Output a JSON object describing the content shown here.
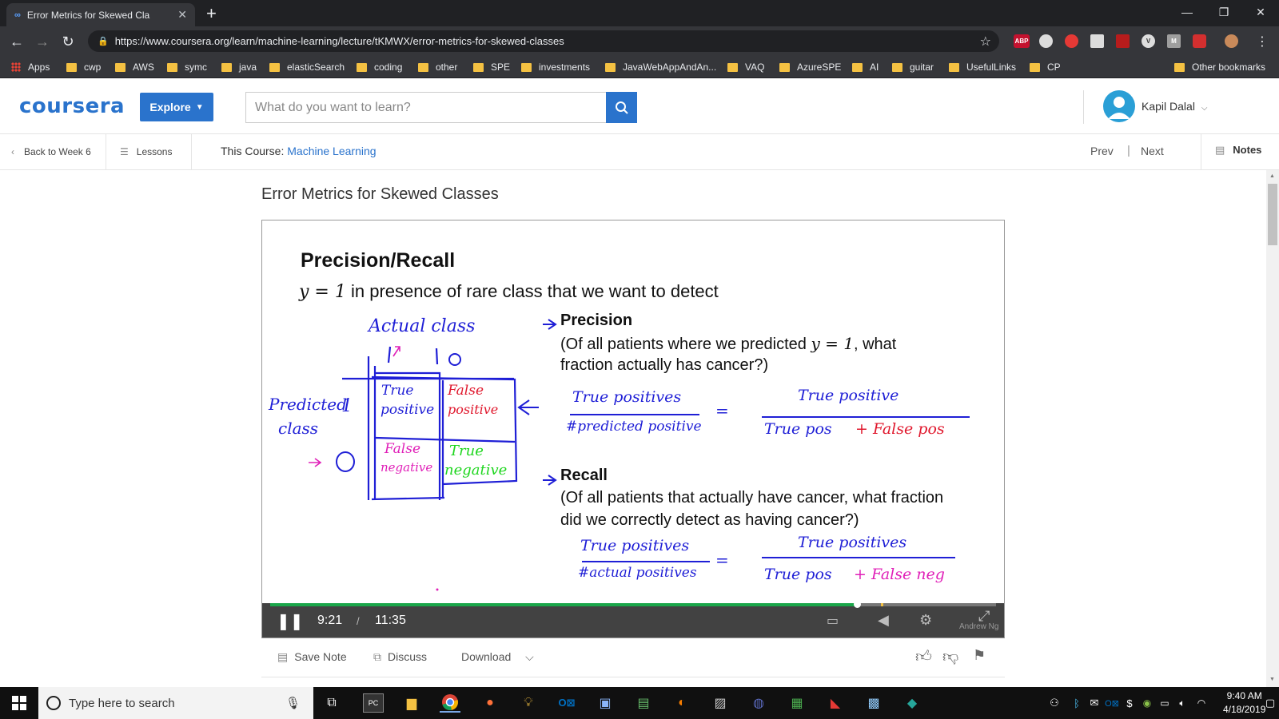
{
  "browser": {
    "tab_title": "Error Metrics for Skewed Cla",
    "url": "https://www.coursera.org/learn/machine-learning/lecture/tKMWX/error-metrics-for-skewed-classes",
    "bookmarks": [
      "Apps",
      "cwp",
      "AWS",
      "symc",
      "java",
      "elasticSearch",
      "coding",
      "other",
      "SPE",
      "investments",
      "JavaWebAppAndAn...",
      "VAQ",
      "AzureSPE",
      "AI",
      "guitar",
      "UsefulLinks",
      "CP"
    ],
    "other_bookmarks": "Other bookmarks",
    "extensions": [
      "ABP",
      "",
      "",
      "",
      "",
      "V",
      "M",
      ""
    ]
  },
  "header": {
    "logo": "coursera",
    "explore_label": "Explore",
    "search_placeholder": "What do you want to learn?",
    "user_name": "Kapil Dalal"
  },
  "course_nav": {
    "back": "Back to Week 6",
    "lessons": "Lessons",
    "course_prefix": "This Course:",
    "course_name": "Machine Learning",
    "prev": "Prev",
    "next": "Next",
    "notes": "Notes"
  },
  "lecture": {
    "title": "Error Metrics for Skewed Classes"
  },
  "slide": {
    "heading": "Precision/Recall",
    "subtitle": "in presence of rare class that we want to detect",
    "subtitle_math": "y = 1",
    "precision_title": "Precision",
    "precision_line1a": "(Of all patients where we predicted",
    "precision_line1_math": "y = 1",
    "precision_line1b": ", what",
    "precision_line2": "fraction actually has cancer?)",
    "recall_title": "Recall",
    "recall_line1": "(Of all patients that actually have cancer, what fraction",
    "recall_line2": "did we correctly detect as having cancer?)",
    "hw_actual_class": "Actual class",
    "hw_one": "1",
    "hw_zero": "0",
    "hw_predicted_class_1": "Predicted",
    "hw_predicted_class_2": "class",
    "hw_pred_one": "1",
    "hw_pred_zero": "0",
    "hw_tp1": "True",
    "hw_tp2": "positive",
    "hw_fp1": "False",
    "hw_fp2": "positive",
    "hw_fn1": "False",
    "hw_fn2": "negative",
    "hw_tn1": "True",
    "hw_tn2": "negative",
    "hw_p_num": "True positives",
    "hw_p_den": "#predicted positive",
    "hw_p_num2": "True positive",
    "hw_p_den2a": "True pos",
    "hw_p_den2b": "+ False pos",
    "hw_r_num": "True positives",
    "hw_r_den": "#actual positives",
    "hw_r_num2": "True positives",
    "hw_r_den2a": "True pos",
    "hw_r_den2b": "+ False neg",
    "hw_eq": "=",
    "watermark": "Andrew Ng"
  },
  "player": {
    "current_time": "9:21",
    "separator": "/",
    "duration": "11:35",
    "progress": 0.808
  },
  "below_player": {
    "save_note": "Save Note",
    "discuss": "Discuss",
    "download": "Download"
  },
  "taskbar": {
    "search_placeholder": "Type here to search",
    "time": "9:40 AM",
    "date": "4/18/2019"
  },
  "colors": {
    "coursera_blue": "#2a73cc",
    "ink_blue": "#1f1fd6",
    "ink_red": "#e0182d",
    "ink_magenta": "#e020b8",
    "ink_green": "#1fd61f",
    "progress_green": "#1aa64a"
  }
}
